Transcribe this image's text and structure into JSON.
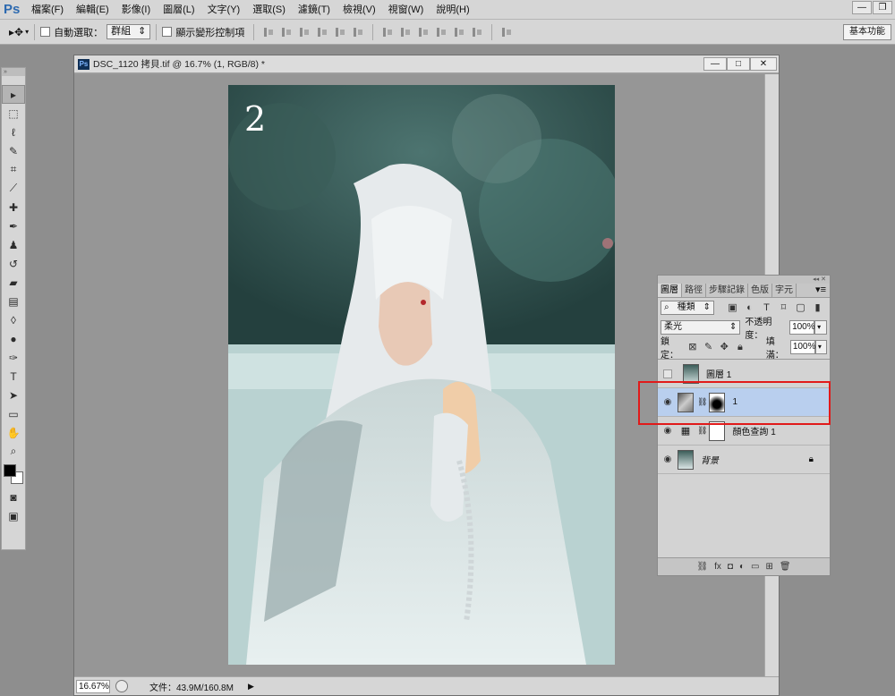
{
  "app": {
    "logo": "Ps"
  },
  "menu": [
    "檔案(F)",
    "編輯(E)",
    "影像(I)",
    "圖層(L)",
    "文字(Y)",
    "選取(S)",
    "濾鏡(T)",
    "檢視(V)",
    "視窗(W)",
    "說明(H)"
  ],
  "options": {
    "auto_select_label": "自動選取：",
    "auto_select_value": "群組",
    "transform_controls_label": "顯示變形控制項",
    "workspace": "基本功能"
  },
  "document": {
    "title": "DSC_1120 拷貝.tif @ 16.7% (1, RGB/8) *",
    "image_number": "2",
    "zoom": "16.67%",
    "file_info": "文件：43.9M/160.8M"
  },
  "layers_panel": {
    "tabs": [
      "圖層",
      "路徑",
      "步驟記錄",
      "色版",
      "字元"
    ],
    "filter_kind": "種類",
    "blend_mode": "柔光",
    "opacity_label": "不透明度：",
    "opacity": "100%",
    "lock_label": "鎖定：",
    "fill_label": "填滿：",
    "fill": "100%",
    "layers": [
      {
        "name": "圖層 1",
        "visible": false,
        "selected": false
      },
      {
        "name": "1",
        "visible": true,
        "selected": true
      },
      {
        "name": "顏色查詢 1",
        "visible": true,
        "selected": false
      },
      {
        "name": "背景",
        "visible": true,
        "selected": false
      }
    ]
  },
  "colors": {
    "highlight_frame": "#e11a1a",
    "selected_layer": "#b9cfee"
  }
}
